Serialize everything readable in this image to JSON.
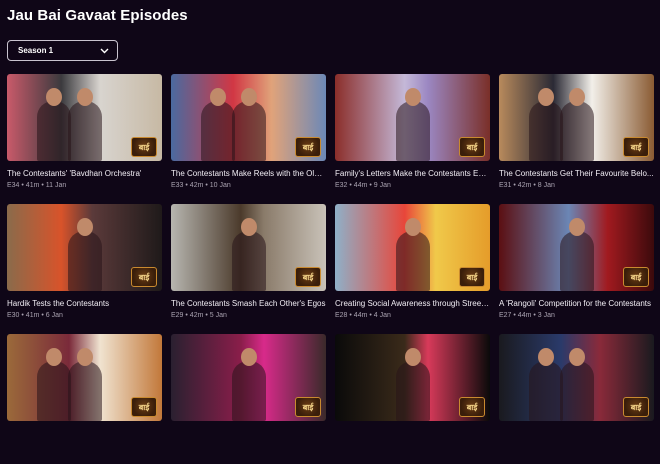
{
  "page": {
    "title": "Jau Bai Gavaat Episodes"
  },
  "season_select": {
    "selected": "Season 1",
    "icon": "chevron-down-icon"
  },
  "channel_logo": {
    "icon": "colors-marathi-logo",
    "text": "बाई"
  },
  "episodes": [
    {
      "title": "The Contestants' 'Bavdhan Orchestra'",
      "meta": "E34 • 41m • 11 Jan"
    },
    {
      "title": "The Contestants Make Reels with the Old ...",
      "meta": "E33 • 42m • 10 Jan"
    },
    {
      "title": "Family's Letters Make the Contestants Em...",
      "meta": "E32 • 44m • 9 Jan"
    },
    {
      "title": "The Contestants Get Their Favourite Belo...",
      "meta": "E31 • 42m • 8 Jan"
    },
    {
      "title": "Hardik Tests the Contestants",
      "meta": "E30 • 41m • 6 Jan"
    },
    {
      "title": "The Contestants Smash Each Other's Egos",
      "meta": "E29 • 42m • 5 Jan"
    },
    {
      "title": "Creating Social Awareness through Street ...",
      "meta": "E28 • 44m • 4 Jan"
    },
    {
      "title": "A 'Rangoli' Competition for the Contestants",
      "meta": "E27 • 44m • 3 Jan"
    },
    {
      "title": "",
      "meta": ""
    },
    {
      "title": "",
      "meta": ""
    },
    {
      "title": "",
      "meta": ""
    },
    {
      "title": "",
      "meta": ""
    }
  ]
}
